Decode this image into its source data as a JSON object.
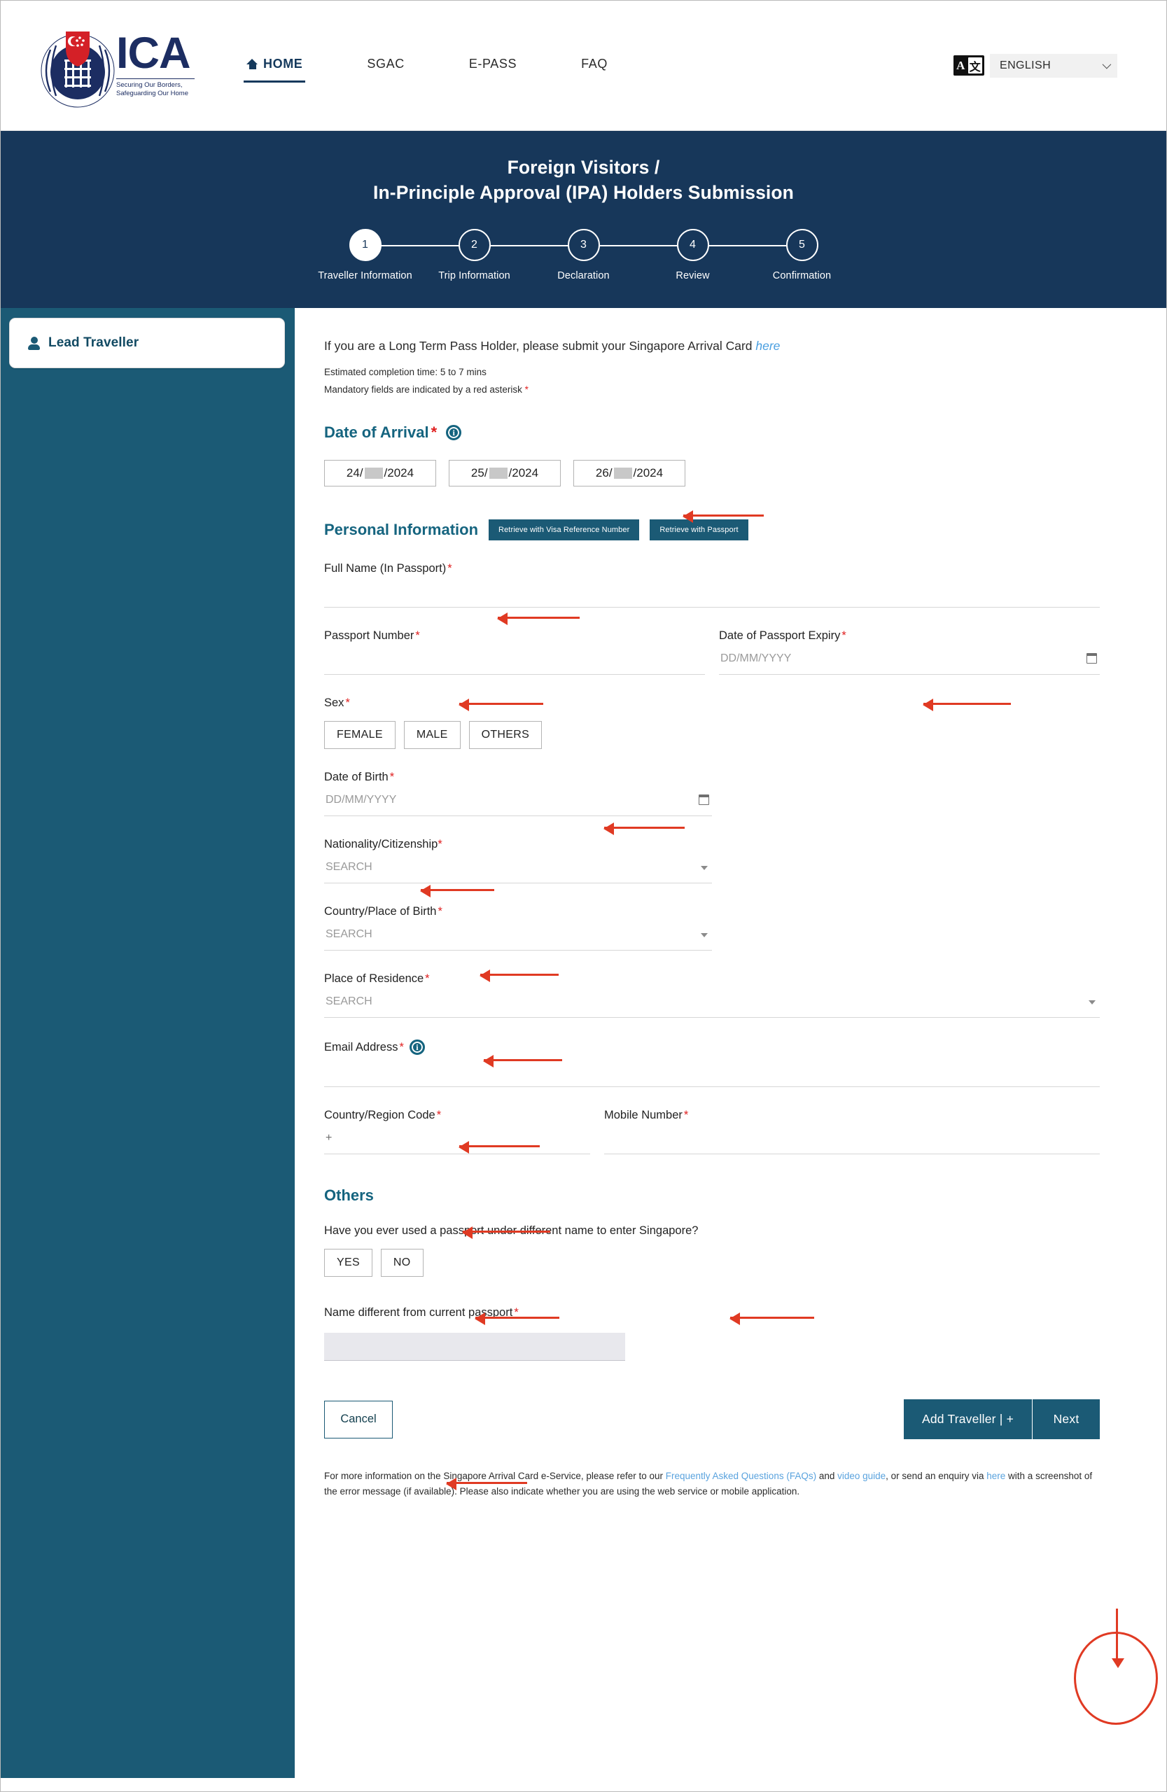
{
  "nav": {
    "logo_title": "ICA",
    "logo_tagline_line1": "Securing Our Borders,",
    "logo_tagline_line2": "Safeguarding Our Home",
    "items": [
      {
        "label": "HOME",
        "icon": "home-icon",
        "active": true
      },
      {
        "label": "SGAC",
        "active": false
      },
      {
        "label": "E-PASS",
        "active": false
      },
      {
        "label": "FAQ",
        "active": false
      }
    ],
    "language": {
      "icon": "translate-icon",
      "icon_left_glyph": "A",
      "icon_right_glyph": "文",
      "selected": "ENGLISH",
      "chevron": "chevron-down-icon"
    }
  },
  "banner": {
    "title_line1": "Foreign Visitors /",
    "title_line2": "In-Principle Approval (IPA) Holders Submission",
    "steps": [
      {
        "number": "1",
        "label": "Traveller Information",
        "current": true
      },
      {
        "number": "2",
        "label": "Trip Information",
        "current": false
      },
      {
        "number": "3",
        "label": "Declaration",
        "current": false
      },
      {
        "number": "4",
        "label": "Review",
        "current": false
      },
      {
        "number": "5",
        "label": "Confirmation",
        "current": false
      }
    ]
  },
  "sidebar": {
    "tab": {
      "label": "Lead Traveller",
      "icon": "person-icon"
    }
  },
  "main": {
    "intro_text": "If you are a Long Term Pass Holder, please submit your Singapore Arrival Card ",
    "intro_link": "here",
    "estimated_time": "Estimated completion time: 5 to 7 mins",
    "mandatory_note": "Mandatory fields are indicated by a red asterisk ",
    "asterisk": "*",
    "date_of_arrival": {
      "label": "Date of Arrival ",
      "info_icon": "info-icon",
      "info_glyph": "i",
      "options": [
        {
          "day": "24/",
          "month_redacted": true,
          "year": "/2024"
        },
        {
          "day": "25/",
          "month_redacted": true,
          "year": "/2024"
        },
        {
          "day": "26/",
          "month_redacted": true,
          "year": "/2024"
        }
      ]
    },
    "personal_information": {
      "title": "Personal Information",
      "retrieve_visa_button": "Retrieve with Visa Reference Number",
      "retrieve_passport_button": "Retrieve with Passport"
    },
    "fields": {
      "full_name": {
        "label": "Full Name (In Passport) ",
        "value": "",
        "placeholder": ""
      },
      "passport_number": {
        "label": "Passport Number ",
        "value": "",
        "placeholder": ""
      },
      "passport_expiry": {
        "label": "Date of Passport Expiry ",
        "value": "",
        "placeholder": "DD/MM/YYYY",
        "icon": "calendar-icon"
      },
      "sex": {
        "label": "Sex ",
        "options": [
          "FEMALE",
          "MALE",
          "OTHERS"
        ]
      },
      "date_of_birth": {
        "label": "Date of Birth ",
        "value": "",
        "placeholder": "DD/MM/YYYY",
        "icon": "calendar-icon"
      },
      "nationality": {
        "label": "Nationality/Citizenship ",
        "value": "",
        "placeholder": "SEARCH",
        "icon": "dropdown-arrow-icon"
      },
      "country_of_birth": {
        "label": "Country/Place of Birth ",
        "value": "",
        "placeholder": "SEARCH",
        "icon": "dropdown-arrow-icon"
      },
      "place_of_residence": {
        "label": "Place of Residence ",
        "value": "",
        "placeholder": "SEARCH",
        "icon": "dropdown-arrow-icon"
      },
      "email": {
        "label": "Email Address ",
        "value": "",
        "placeholder": "",
        "info_icon": "info-icon",
        "info_glyph": "i"
      },
      "country_region_code": {
        "label": "Country/Region Code ",
        "value": "+",
        "placeholder": ""
      },
      "mobile_number": {
        "label": "Mobile Number ",
        "value": "",
        "placeholder": ""
      }
    },
    "others": {
      "title": "Others",
      "question": "Have you ever used a passport under different name to enter Singapore?",
      "options": [
        "YES",
        "NO"
      ],
      "name_different_label": "Name different from current passport ",
      "name_different_value": ""
    },
    "buttons": {
      "cancel": "Cancel",
      "add_traveller": "Add Traveller | +",
      "next": "Next"
    },
    "footer": {
      "part1": "For more information on the Singapore Arrival Card e-Service, please refer to our ",
      "link_faq": "Frequently Asked Questions (FAQs)",
      "part2": " and ",
      "link_video": "video guide",
      "part3": ", or send an enquiry via ",
      "link_here": "here",
      "part4": " with a screenshot of the error message (if available). Please also indicate whether you are using the web service or mobile application."
    }
  },
  "colors": {
    "banner_navy": "#17375a",
    "sidebar_teal": "#1b5a75",
    "heading_teal": "#15647f",
    "accent_button": "#1b5a75",
    "annotation_red": "#e03a23",
    "link_blue": "#5aa3de",
    "required_red": "#e02020"
  }
}
